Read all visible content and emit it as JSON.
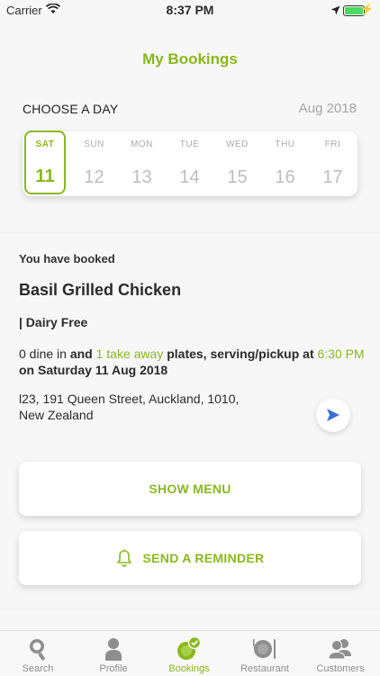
{
  "status_bar": {
    "carrier": "Carrier",
    "time": "8:37 PM"
  },
  "header": {
    "title": "My Bookings"
  },
  "day_picker": {
    "label": "CHOOSE A DAY",
    "month": "Aug 2018",
    "days": [
      {
        "dow": "SAT",
        "num": "11",
        "selected": true
      },
      {
        "dow": "SUN",
        "num": "12"
      },
      {
        "dow": "MON",
        "num": "13"
      },
      {
        "dow": "TUE",
        "num": "14"
      },
      {
        "dow": "WED",
        "num": "15"
      },
      {
        "dow": "THU",
        "num": "16"
      },
      {
        "dow": "FRI",
        "num": "17"
      }
    ]
  },
  "booking": {
    "booked_label": "You have booked",
    "dish_name": "Basil Grilled Chicken",
    "dietary": "| Dairy Free",
    "dine_in": "0 dine in",
    "and_text": "and",
    "take_away": "1 take away",
    "plates_text": "plates, serving/pickup at",
    "time": "6:30 PM",
    "on_text": "on Saturday 11 Aug 2018",
    "address_line1": "l23, 191 Queen Street, Auckland, 1010,",
    "address_line2": "New Zealand"
  },
  "actions": {
    "show_menu": "SHOW MENU",
    "send_reminder": "SEND A REMINDER"
  },
  "tab_bar": {
    "tabs": [
      {
        "label": "Search",
        "icon": "search-icon"
      },
      {
        "label": "Profile",
        "icon": "profile-icon"
      },
      {
        "label": "Bookings",
        "icon": "bookings-icon",
        "active": true
      },
      {
        "label": "Restaurant",
        "icon": "restaurant-icon"
      },
      {
        "label": "Customers",
        "icon": "customers-icon"
      }
    ]
  },
  "colors": {
    "accent": "#8ab81e",
    "background": "#f7f7f7",
    "muted": "#a4a4a4",
    "nav_arrow": "#3a6fd8"
  }
}
